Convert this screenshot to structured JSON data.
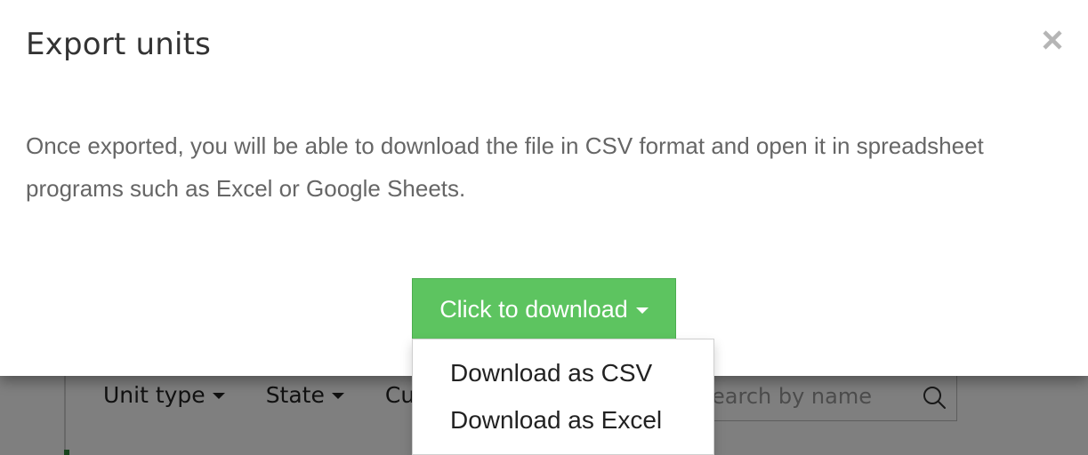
{
  "modal": {
    "title": "Export units",
    "close_icon": "close-icon",
    "description": "Once exported, you will be able to download the file in CSV format and open it in spreadsheet programs such as Excel or Google Sheets.",
    "download_button": {
      "label": "Click to download",
      "color": "#5dc460"
    },
    "dropdown": {
      "items": [
        {
          "label": "Download as CSV"
        },
        {
          "label": "Download as Excel"
        }
      ]
    }
  },
  "background": {
    "filters": [
      {
        "label": "Unit type"
      },
      {
        "label": "State"
      },
      {
        "label": "Cu"
      }
    ],
    "search": {
      "placeholder": "earch by name",
      "icon": "search-icon"
    }
  }
}
